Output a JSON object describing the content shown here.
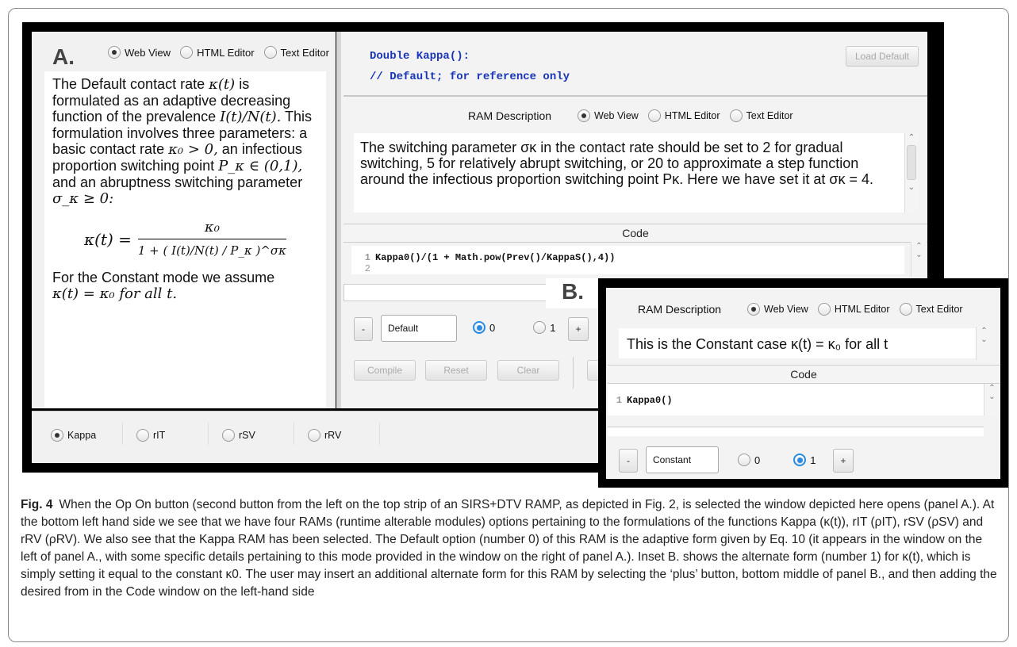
{
  "panelA": {
    "label": "A.",
    "left_view": {
      "options": [
        "Web View",
        "HTML Editor",
        "Text Editor"
      ],
      "selected": "Web View"
    },
    "webview_text": {
      "p1_a": "The Default contact rate ",
      "p1_kt": "κ(t)",
      "p1_b": " is formulated as an adaptive decreasing function of the prevalence ",
      "p1_frac": "I(t)/N(t).",
      "p1_c": " This formulation involves three parameters: a basic contact rate ",
      "p1_k0": "κ₀ > 0,",
      "p1_d": " an infectious proportion switching point ",
      "p1_pk": "P_κ ∈ (0,1),",
      "p1_e": " and an abruptness switching parameter",
      "p1_sig": "σ_κ ≥ 0:",
      "formula_lhs": "κ(t) =",
      "formula_num": "κ₀",
      "formula_den": "1 + ( I(t)/N(t) / P_κ )^σκ",
      "p2_a": "For the Constant mode we assume",
      "p2_b": "κ(t) = κ₀ for all t."
    },
    "code_header": {
      "line1": "Double Kappa():",
      "line2": "// Default; for reference only"
    },
    "load_default": "Load Default",
    "ram_description": {
      "title": "RAM Description",
      "options": [
        "Web View",
        "HTML Editor",
        "Text Editor"
      ],
      "selected": "Web View"
    },
    "description_text": "The switching parameter σκ in the contact rate should be set to 2 for gradual switching, 5 for relatively abrupt switching, or 20 to approximate a step function around the infectious proportion switching point Pκ.  Here we have set it at σκ = 4.",
    "code_title": "Code",
    "code_lines": [
      {
        "num": "1",
        "text": "Kappa0()/(1 + Math.pow(Prev()/KappaS(),4))"
      },
      {
        "num": "2",
        "text": ""
      }
    ],
    "minus": "-",
    "mode_name": "Default",
    "mode_options": [
      "0",
      "1"
    ],
    "mode_selected": "0",
    "plus": "+",
    "buttons": {
      "compile": "Compile",
      "reset": "Reset",
      "clear": "Clear"
    },
    "rams": [
      {
        "label": "Kappa",
        "selected": true
      },
      {
        "label": "rIT",
        "selected": false
      },
      {
        "label": "rSV",
        "selected": false
      },
      {
        "label": "rRV",
        "selected": false
      }
    ]
  },
  "panelB": {
    "label": "B.",
    "ram_description": {
      "title": "RAM Description",
      "options": [
        "Web View",
        "HTML Editor",
        "Text Editor"
      ],
      "selected": "Web View"
    },
    "description_text": "This is the Constant case κ(t) = κ₀ for all t",
    "code_title": "Code",
    "code_lines": [
      {
        "num": "1",
        "text": "Kappa0()"
      }
    ],
    "minus": "-",
    "mode_name": "Constant",
    "mode_options": [
      "0",
      "1"
    ],
    "mode_selected": "1",
    "plus": "+"
  },
  "caption": {
    "fig": "Fig. 4",
    "text": "When the Op On button (second button from the left on the top strip of an SIRS+DTV RAMP, as depicted in Fig. 2, is selected the window depicted here opens (panel A.). At the bottom left hand side we see that we have four RAMs (runtime alterable modules) options pertaining to the formulations of the functions Kappa (κ(t)), rIT (ρIT), rSV (ρSV) and rRV (ρRV). We also see that the Kappa RAM has been selected. The Default option (number 0) of this RAM is the adaptive form given by Eq. 10 (it appears in the window on the left of panel A., with some specific details pertaining to this mode provided in the window on the right of panel A.). Inset B. shows the alternate form (number 1) for κ(t), which is simply setting it equal to the constant κ0. The user may insert an additional alternate form for this RAM by selecting the ‘plus’ button, bottom middle of panel B., and then adding the desired from in the Code window on the left-hand side"
  }
}
